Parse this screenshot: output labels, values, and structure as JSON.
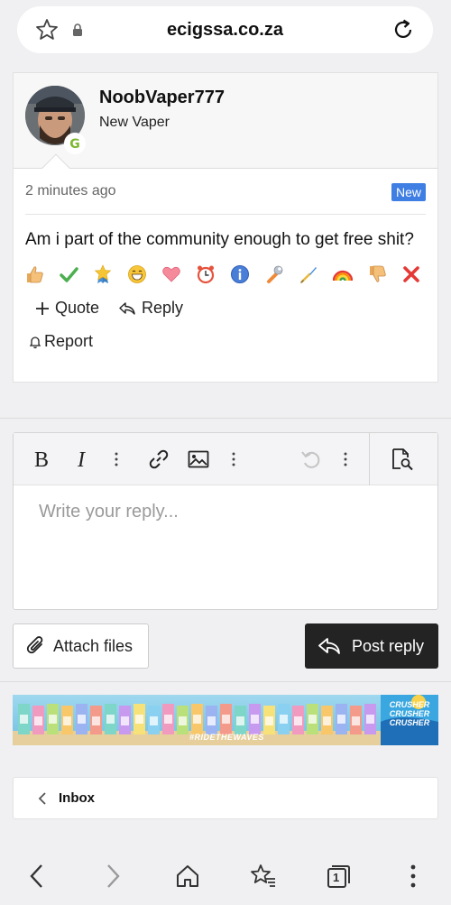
{
  "browser": {
    "url": "ecigssa.co.za",
    "tab_count": "1"
  },
  "post": {
    "username": "NoobVaper777",
    "user_title": "New Vaper",
    "timestamp": "2 minutes ago",
    "badge": "New",
    "body": "Am i part of the community enough to get free shit?",
    "reactions": [
      "thumbs-up",
      "check",
      "star-medal",
      "grin",
      "heart",
      "alarm-clock",
      "info",
      "wrench",
      "brush",
      "rainbow",
      "thumbs-down",
      "cross"
    ],
    "actions": {
      "quote": "Quote",
      "reply": "Reply",
      "report": "Report"
    }
  },
  "editor": {
    "placeholder": "Write your reply...",
    "toolbar": [
      "bold-icon",
      "italic-icon",
      "more-icon",
      "link-icon",
      "image-icon",
      "more-icon",
      "undo-icon",
      "more-icon",
      "preview-icon"
    ],
    "attach_label": "Attach files",
    "post_label": "Post reply"
  },
  "banner": {
    "hashtag": "#RIDETHEWAVES",
    "brand": "CRUSHER CRUSHER CRUSHER"
  },
  "inbox": {
    "label": "Inbox"
  },
  "colors": {
    "badge": "#3f7ee3",
    "post_button": "#232323",
    "avatar_badge": "#7cb82f"
  }
}
